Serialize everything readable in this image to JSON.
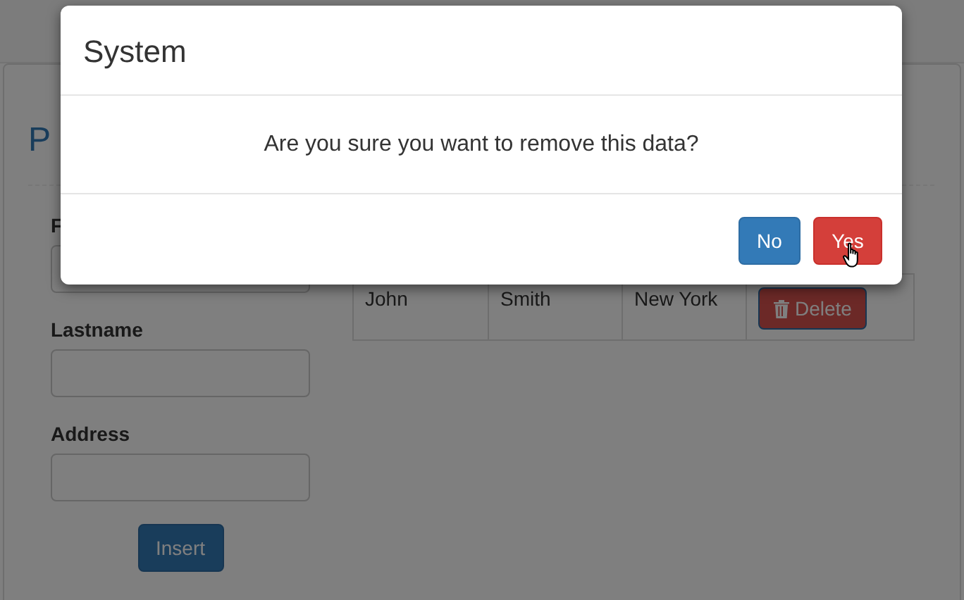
{
  "page": {
    "title": "P"
  },
  "form": {
    "fields": [
      {
        "label": "F"
      },
      {
        "label": "Lastname"
      },
      {
        "label": "Address"
      }
    ],
    "submit": "Insert"
  },
  "table": {
    "rows": [
      {
        "cells": [
          "John",
          "Smith",
          "New York"
        ],
        "action": "Delete"
      }
    ]
  },
  "dialog": {
    "title": "System",
    "message": "Are you sure you want to remove this data?",
    "buttons": [
      {
        "label": "No",
        "kind": "default"
      },
      {
        "label": "Yes",
        "kind": "danger"
      }
    ]
  }
}
